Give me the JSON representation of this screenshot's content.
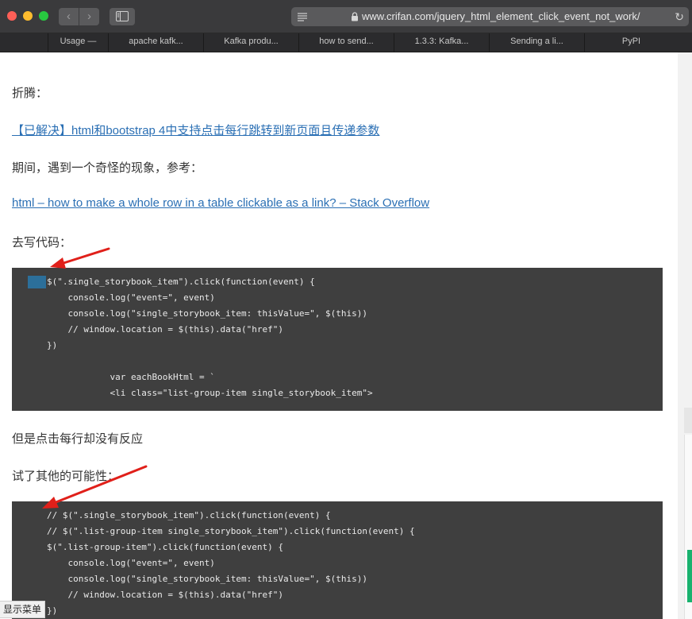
{
  "browser": {
    "url": "www.crifan.com/jquery_html_element_click_event_not_work/",
    "tabs": [
      "Usage —",
      "apache kafk...",
      "Kafka produ...",
      "how to send...",
      "1.3.3: Kafka...",
      "Sending a li...",
      "PyPI"
    ]
  },
  "article": {
    "para1": "折腾：",
    "link1": "【已解决】html和bootstrap 4中支持点击每行跳转到新页面且传递参数",
    "para2": "期间，遇到一个奇怪的现象，参考：",
    "link2": "html – how to make a whole row in a table clickable as a link? – Stack Overflow",
    "para3": "去写代码：",
    "code1": [
      "$(\".single_storybook_item\").click(function(event) {",
      "    console.log(\"event=\", event)",
      "    console.log(\"single_storybook_item: thisValue=\", $(this))",
      "    // window.location = $(this).data(\"href\")",
      "})",
      "",
      "            var eachBookHtml = `",
      "            <li class=\"list-group-item single_storybook_item\">"
    ],
    "para4": "但是点击每行却没有反应",
    "para5": "试了其他的可能性：",
    "code2": [
      "// $(\".single_storybook_item\").click(function(event) {",
      "// $(\".list-group-item single_storybook_item\").click(function(event) {",
      "$(\".list-group-item\").click(function(event) {",
      "    console.log(\"event=\", event)",
      "    console.log(\"single_storybook_item: thisValue=\", $(this))",
      "    // window.location = $(this).data(\"href\")",
      "})"
    ]
  },
  "status_chip": "显示菜单",
  "colors": {
    "link": "#2a6fb4",
    "code_bg": "#3f3f3f",
    "arrow": "#e0201a"
  }
}
